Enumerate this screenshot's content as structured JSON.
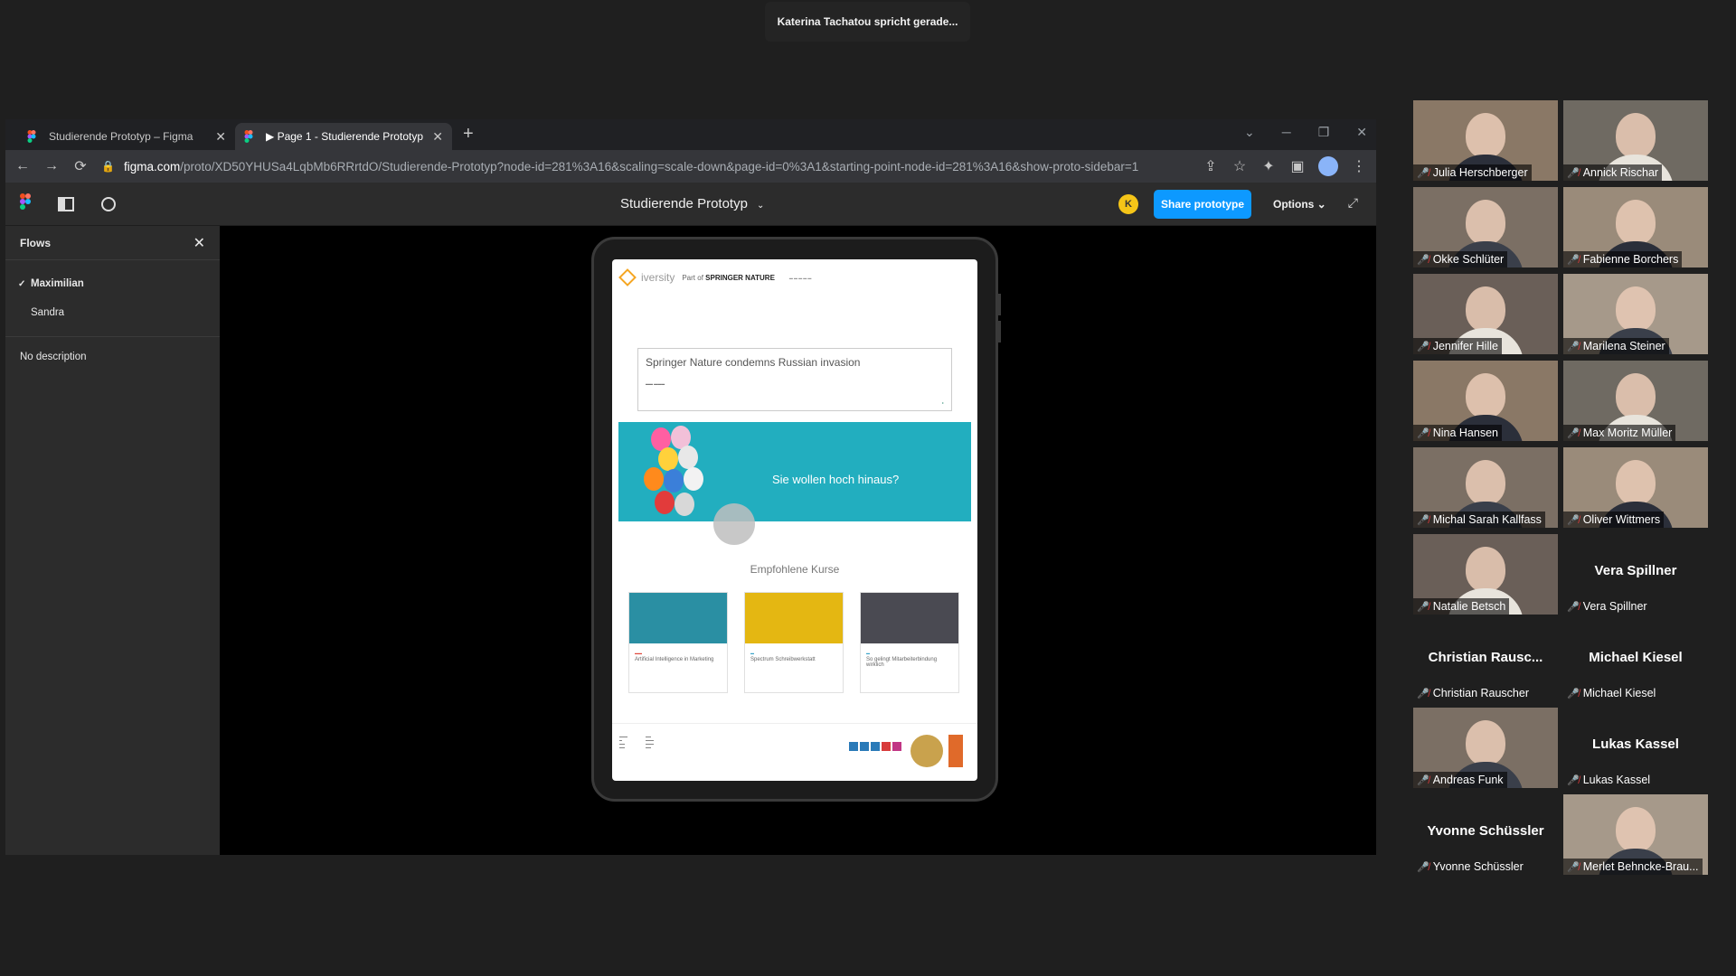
{
  "meeting": {
    "speaking_banner": "Katerina Tachatou spricht gerade..."
  },
  "browser": {
    "tabs": [
      {
        "title": "Studierende Prototyp – Figma",
        "active": false
      },
      {
        "title": "▶ Page 1 - Studierende Prototyp",
        "active": true
      }
    ],
    "new_tab": "+",
    "url_host": "figma.com",
    "url_path": "/proto/XD50YHUSa4LqbMb6RRrtdO/Studierende-Prototyp?node-id=281%3A16&scaling=scale-down&page-id=0%3A1&starting-point-node-id=281%3A16&show-proto-sidebar=1"
  },
  "figma": {
    "title": "Studierende Prototyp",
    "user_initial": "K",
    "share_label": "Share prototype",
    "options_label": "Options",
    "flows": {
      "heading": "Flows",
      "items": [
        {
          "label": "Maximilian",
          "selected": true
        },
        {
          "label": "Sandra",
          "selected": false
        }
      ],
      "description": "No description"
    }
  },
  "prototype_site": {
    "brand": "iversity",
    "part_of": "Part of",
    "part_brand": "SPRINGER NATURE",
    "news_title": "Springer Nature condemns Russian invasion",
    "hero_headline": "Sie wollen hoch hinaus?",
    "section_title": "Empfohlene Kurse",
    "courses": [
      {
        "name": "Artificial Intelligence in Marketing"
      },
      {
        "name": "Spectrum Schreibwerkstatt"
      },
      {
        "name": "So gelingt Mitarbeiterbindung wirklich"
      }
    ]
  },
  "participants": [
    {
      "label": "Julia Herschberger",
      "video": true
    },
    {
      "label": "Annick Rischar",
      "video": true
    },
    {
      "label": "Okke Schlüter",
      "video": true
    },
    {
      "label": "Fabienne Borchers",
      "video": true
    },
    {
      "label": "Jennifer Hille",
      "video": true
    },
    {
      "label": "Marilena Steiner",
      "video": true
    },
    {
      "label": "Nina Hansen",
      "video": true
    },
    {
      "label": "Max Moritz Müller",
      "video": true
    },
    {
      "label": "Michal Sarah Kallfass",
      "video": true
    },
    {
      "label": "Oliver Wittmers",
      "video": true
    },
    {
      "label": "Natalie Betsch",
      "video": true
    },
    {
      "label": "Vera Spillner",
      "video": false,
      "display": "Vera Spillner"
    },
    {
      "label": "Christian Rauscher",
      "video": false,
      "display": "Christian  Rausc..."
    },
    {
      "label": "Michael Kiesel",
      "video": false,
      "display": "Michael Kiesel"
    },
    {
      "label": "Andreas Funk",
      "video": true
    },
    {
      "label": "Lukas Kassel",
      "video": false,
      "display": "Lukas Kassel"
    },
    {
      "label": "Yvonne Schüssler",
      "video": false,
      "display": "Yvonne Schüssler"
    },
    {
      "label": "Merlet Behncke-Brau...",
      "video": true
    }
  ],
  "colors": {
    "accent": "#0d99ff",
    "muted_mic": "#e5393c"
  }
}
